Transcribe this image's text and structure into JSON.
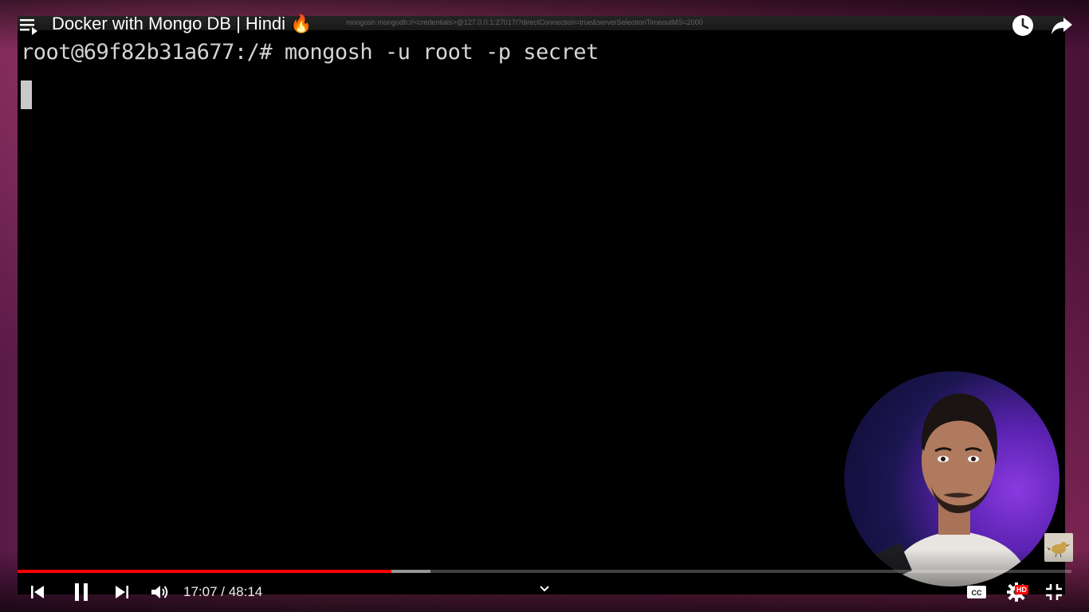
{
  "player": {
    "title": "Docker with Mongo DB | Hindi 🔥",
    "progress_played_fraction": 0.3548,
    "progress_buffered_fraction": 0.3919
  },
  "terminal": {
    "window_title": "mongosh mongodb://<credentials>@127.0.0.1:27017/?directConnection=true&serverSelectionTimeoutMS=2000",
    "command_line": "root@69f82b31a677:/# mongosh -u root -p secret"
  },
  "controls": {
    "time_display": "17:07 / 48:14",
    "hd_badge": "HD"
  },
  "icons": {
    "playlist": "playlist-icon",
    "watch_later": "clock-icon",
    "share": "share-icon",
    "previous": "skip-previous-icon",
    "pause": "pause-icon",
    "next": "skip-next-icon",
    "volume": "volume-icon",
    "chapters": "chevron-down-icon",
    "captions": "closed-captions-icon",
    "settings": "gear-icon",
    "exit_fullscreen": "exit-fullscreen-icon"
  },
  "colors": {
    "progress_played": "#ff0000",
    "hd_badge": "#ff0000",
    "terminal_bg": "#000000",
    "webcam_accent": "#8a3ae0"
  }
}
